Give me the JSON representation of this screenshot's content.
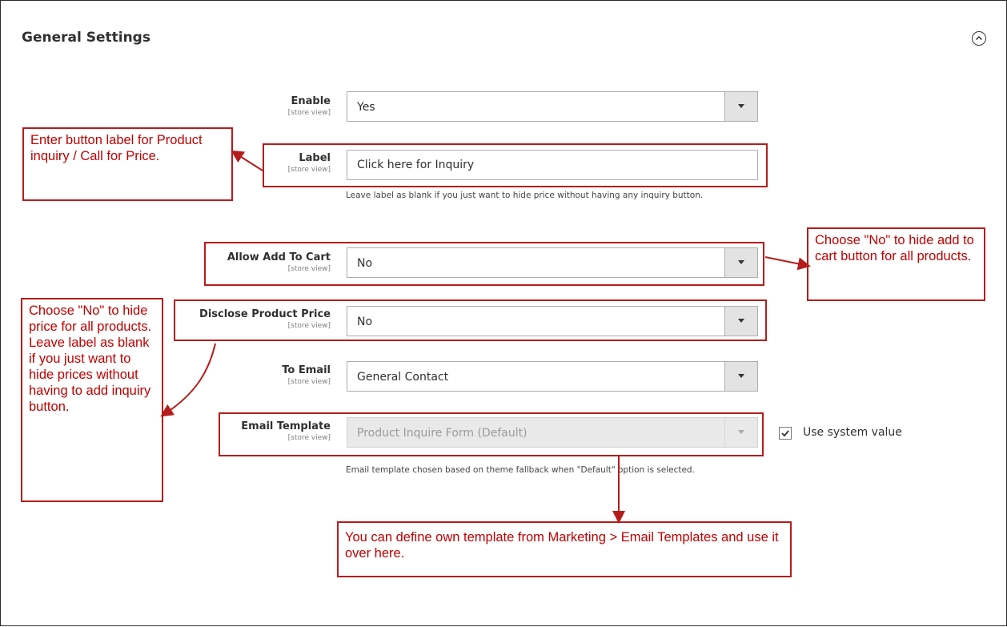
{
  "section": {
    "title": "General Settings"
  },
  "fields": {
    "enable": {
      "label": "Enable",
      "scope": "[store view]",
      "value": "Yes"
    },
    "label": {
      "label": "Label",
      "scope": "[store view]",
      "value": "Click here for Inquiry",
      "note": "Leave label as blank if you just want to hide price without having any inquiry button."
    },
    "allow_add_to_cart": {
      "label": "Allow Add To Cart",
      "scope": "[store view]",
      "value": "No"
    },
    "disclose_price": {
      "label": "Disclose Product Price",
      "scope": "[store view]",
      "value": "No"
    },
    "to_email": {
      "label": "To Email",
      "scope": "[store view]",
      "value": "General Contact"
    },
    "email_template": {
      "label": "Email Template",
      "scope": "[store view]",
      "value": "Product Inquire Form (Default)",
      "note": "Email template chosen based on theme fallback when \"Default\" option is selected.",
      "use_system_value": "Use system value",
      "use_system_checked": true
    }
  },
  "callouts": {
    "label_help": "Enter button label for Product inquiry / Call for Price.",
    "cart_help": "Choose \"No\" to hide add to cart button for all products.",
    "price_help": "Choose \"No\" to hide price for all products. Leave label as blank if you just want to hide prices without having to add inquiry button.",
    "template_help": "You can define own template from Marketing > Email Templates and use it over here."
  },
  "colors": {
    "annotation": "#c00000",
    "annotation_border": "#b71c1c"
  },
  "icons": {
    "collapse": "chevron-up-circle-icon",
    "dropdown": "caret-down-icon",
    "check": "checkmark-icon"
  }
}
